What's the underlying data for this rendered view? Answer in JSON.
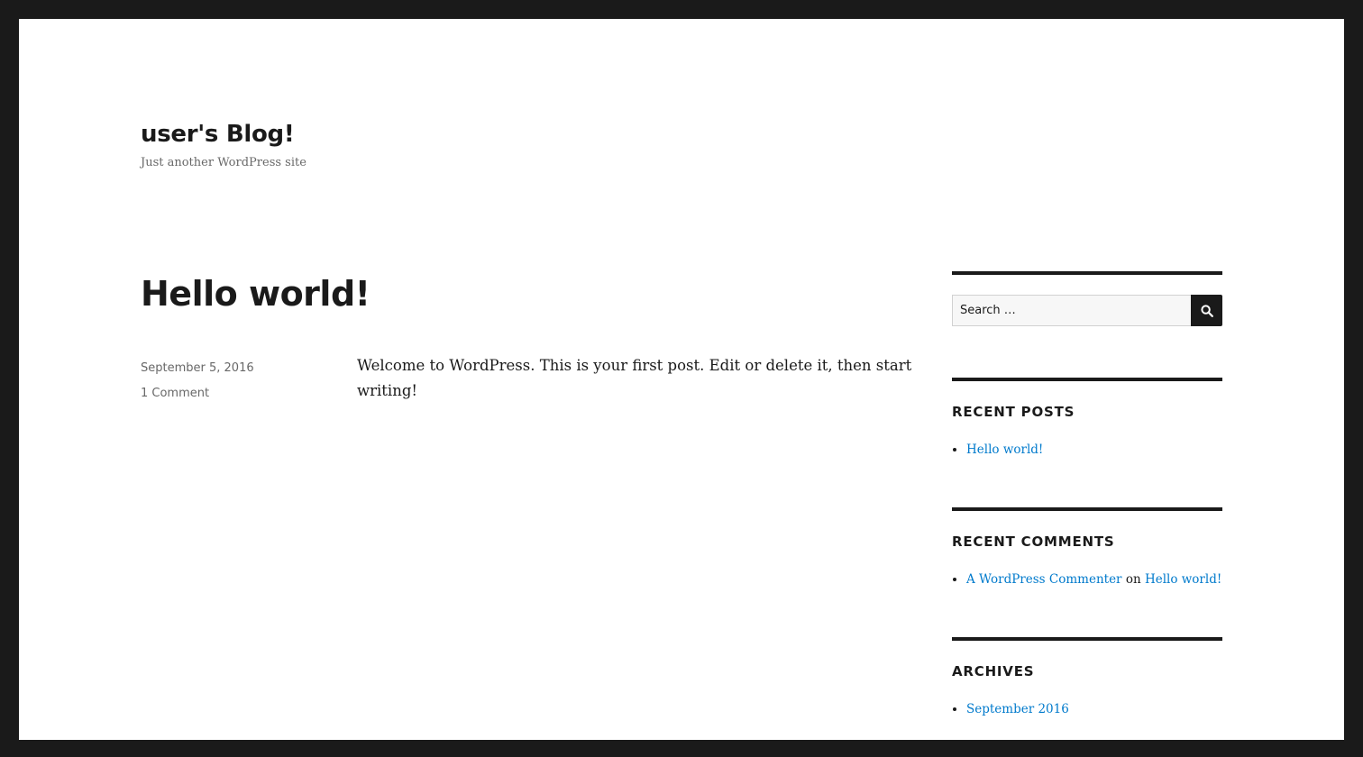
{
  "site": {
    "title": "user's Blog!",
    "description": "Just another WordPress site"
  },
  "post": {
    "title": "Hello world!",
    "date": "September 5, 2016",
    "comments": "1 Comment",
    "content": "Welcome to WordPress. This is your first post. Edit or delete it, then start writing!"
  },
  "sidebar": {
    "search": {
      "placeholder": "Search …",
      "button_icon": "search-icon"
    },
    "recent_posts": {
      "title": "RECENT POSTS",
      "items": [
        "Hello world!"
      ]
    },
    "recent_comments": {
      "title": "RECENT COMMENTS",
      "items": [
        {
          "author": "A WordPress Commenter",
          "on": "on",
          "post": "Hello world!"
        }
      ]
    },
    "archives": {
      "title": "ARCHIVES",
      "items": [
        "September 2016"
      ]
    }
  },
  "colors": {
    "frame": "#1a1a1a",
    "link": "#007acc",
    "meta": "#686868"
  }
}
